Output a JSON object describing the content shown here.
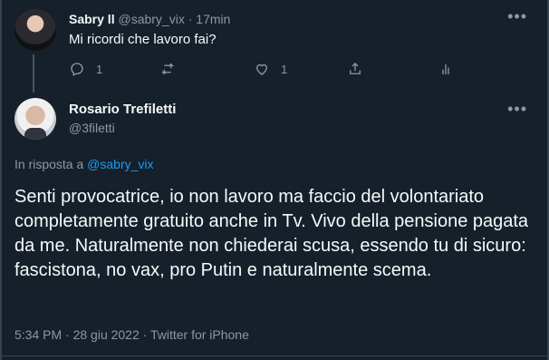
{
  "reply_tweet": {
    "name": "Sabry ll",
    "handle": "@sabry_vix",
    "separator": "·",
    "time": "17min",
    "text": "Mi ricordi che lavoro fai?",
    "reply_count": "1",
    "like_count": "1"
  },
  "main_tweet": {
    "name": "Rosario Trefiletti",
    "handle": "@3filetti",
    "in_reply_prefix": "In risposta a",
    "in_reply_handle": "@sabry_vix",
    "text": "Senti provocatrice, io non lavoro ma faccio del volontariato completamente gratuito anche in Tv. Vivo della pensione pagata da me. Naturalmente non chiederai scusa, essendo tu di sicuro: fascistona, no vax, pro Putin e naturalmente scema.",
    "meta": "5:34 PM · 28 giu 2022 · Twitter for iPhone"
  },
  "icons": {
    "more": "more-horizontal-icon",
    "reply": "reply-icon",
    "retweet": "retweet-icon",
    "like": "heart-icon",
    "share": "share-icon",
    "analytics": "analytics-icon"
  }
}
